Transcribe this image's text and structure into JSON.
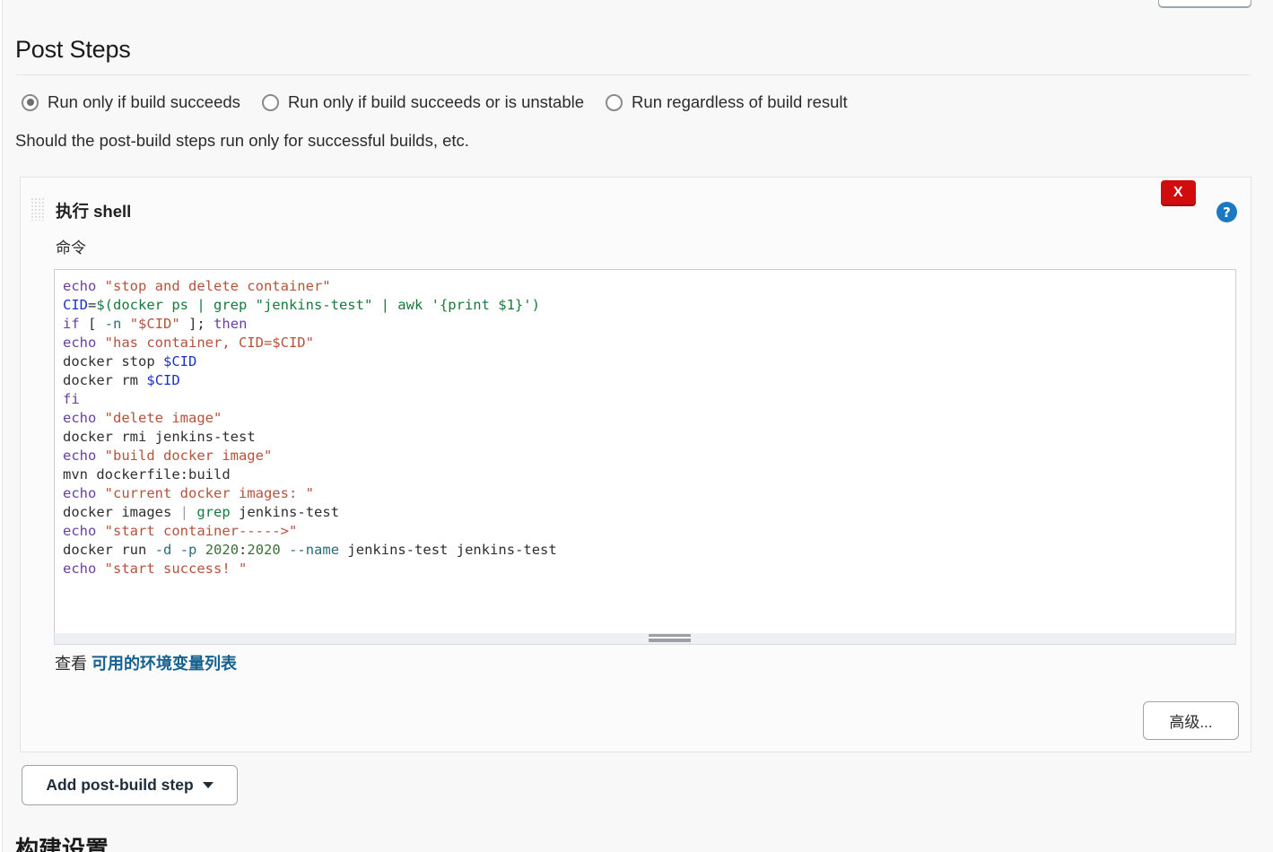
{
  "section": {
    "title": "Post Steps",
    "help_text": "Should the post-build steps run only for successful builds, etc."
  },
  "radios": [
    {
      "label": "Run only if build succeeds",
      "checked": true
    },
    {
      "label": "Run only if build succeeds or is unstable",
      "checked": false
    },
    {
      "label": "Run regardless of build result",
      "checked": false
    }
  ],
  "builder": {
    "title": "执行 shell",
    "field_label": "命令",
    "delete_label": "X",
    "help_label": "?",
    "advanced_label": "高级...",
    "env_lead": "查看 ",
    "env_link": "可用的环境变量列表",
    "script_lines": [
      "echo \"stop and delete container\"",
      "CID=$(docker ps | grep \"jenkins-test\" | awk '{print $1}')",
      "if [ -n \"$CID\" ]; then",
      "echo \"has container, CID=$CID\"",
      "docker stop $CID",
      "docker rm $CID",
      "fi",
      "echo \"delete image\"",
      "docker rmi jenkins-test",
      "echo \"build docker image\"",
      "mvn dockerfile:build",
      "echo \"current docker images: \"",
      "docker images | grep jenkins-test",
      "echo \"start container----->\"",
      "docker run -d -p 2020:2020 --name jenkins-test jenkins-test",
      "echo \"start success! \""
    ]
  },
  "footer": {
    "add_step_label": "Add post-build step",
    "next_section_title": "构建设置"
  },
  "colors": {
    "delete_red": "#d00c0c",
    "help_blue": "#1b79c4",
    "link_blue": "#15618f",
    "panel_bg": "#fbfbfb",
    "page_bg": "#f8f8f8"
  }
}
